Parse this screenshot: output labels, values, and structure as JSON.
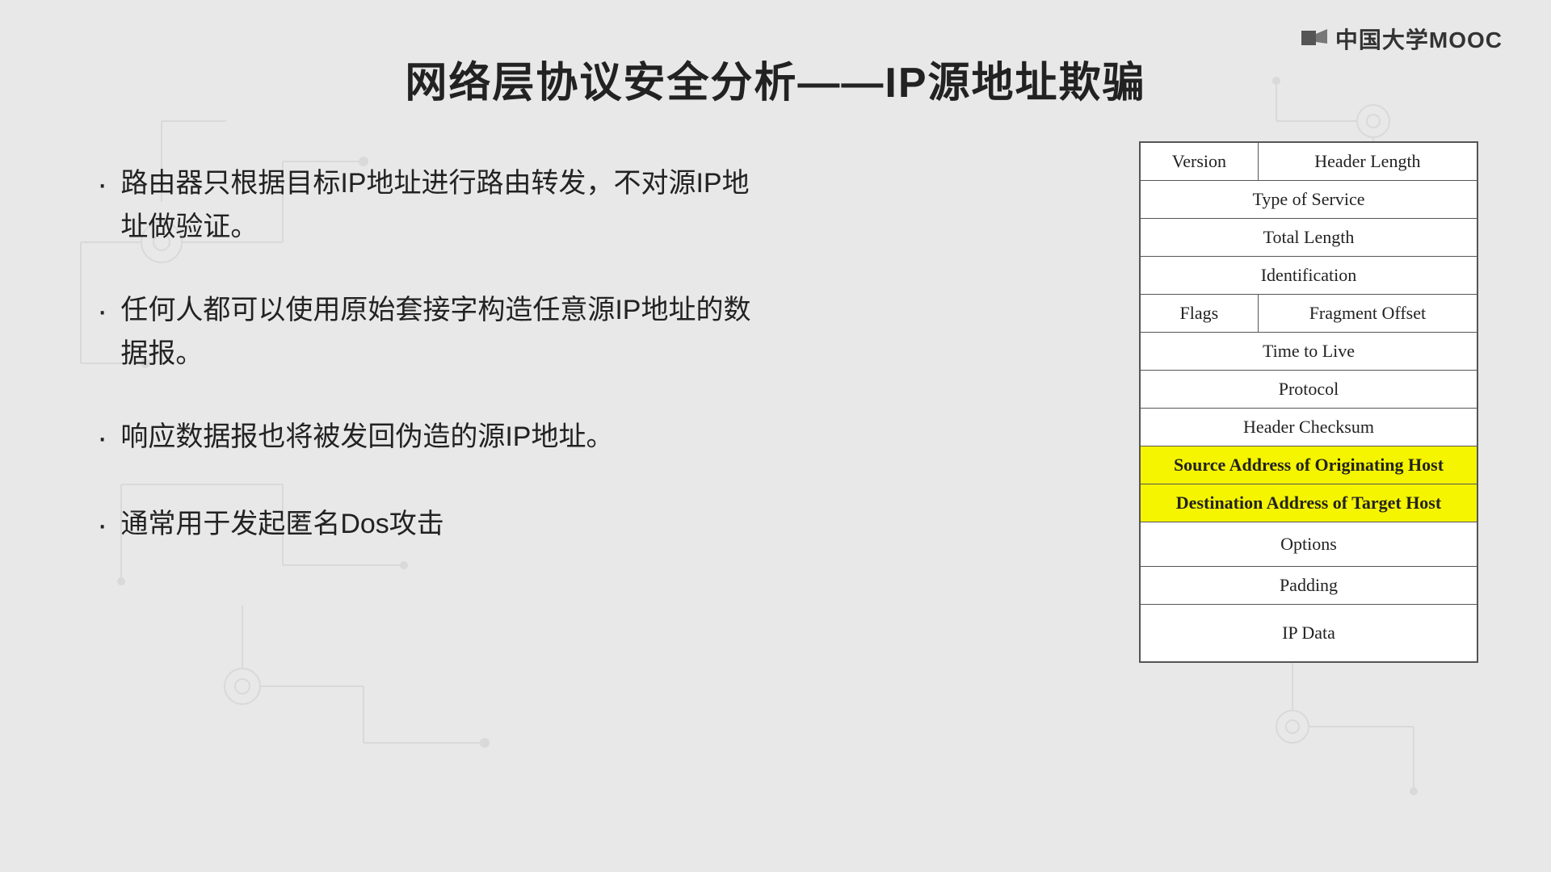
{
  "page": {
    "title": "网络层协议安全分析——IP源地址欺骗",
    "background_color": "#e8e8e8"
  },
  "logo": {
    "icon_label": "mooc-logo-icon",
    "text": "中国大学MOOC"
  },
  "bullets": [
    {
      "id": "bullet-1",
      "text": "路由器只根据目标IP地址进行路由转发，不对源IP地址做验证。"
    },
    {
      "id": "bullet-2",
      "text": "任何人都可以使用原始套接字构造任意源IP地址的数据报。"
    },
    {
      "id": "bullet-3",
      "text": "响应数据报也将被发回伪造的源IP地址。"
    },
    {
      "id": "bullet-4",
      "text": "通常用于发起匿名Dos攻击"
    }
  ],
  "ip_header": {
    "rows": [
      {
        "type": "split",
        "cells": [
          "Version",
          "Header Length"
        ],
        "highlight": false
      },
      {
        "type": "full",
        "cells": [
          "Type of Service"
        ],
        "highlight": false
      },
      {
        "type": "full",
        "cells": [
          "Total Length"
        ],
        "highlight": false
      },
      {
        "type": "full",
        "cells": [
          "Identification"
        ],
        "highlight": false
      },
      {
        "type": "split",
        "cells": [
          "Flags",
          "Fragment Offset"
        ],
        "highlight": false
      },
      {
        "type": "full",
        "cells": [
          "Time to Live"
        ],
        "highlight": false
      },
      {
        "type": "full",
        "cells": [
          "Protocol"
        ],
        "highlight": false
      },
      {
        "type": "full",
        "cells": [
          "Header Checksum"
        ],
        "highlight": false
      },
      {
        "type": "full",
        "cells": [
          "Source Address of Originating Host"
        ],
        "highlight": true
      },
      {
        "type": "full",
        "cells": [
          "Destination Address of Target Host"
        ],
        "highlight": true
      },
      {
        "type": "full",
        "cells": [
          "Options"
        ],
        "highlight": false
      },
      {
        "type": "full",
        "cells": [
          "Padding"
        ],
        "highlight": false
      },
      {
        "type": "full",
        "cells": [
          "IP Data"
        ],
        "highlight": false,
        "tall": true
      }
    ]
  }
}
